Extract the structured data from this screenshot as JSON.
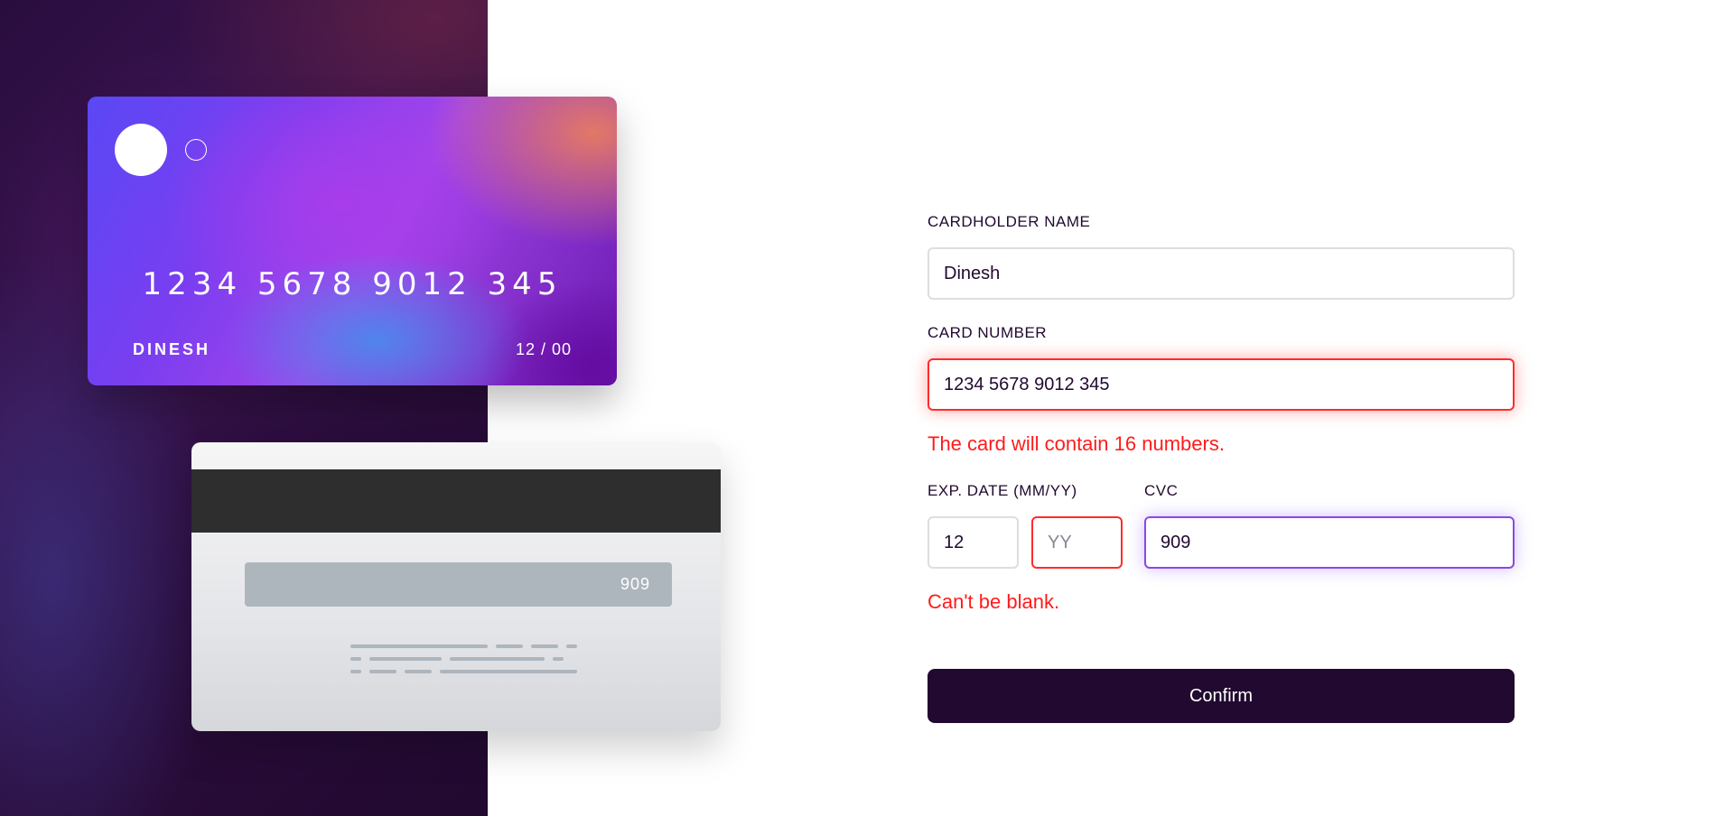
{
  "card_front": {
    "number": "1234 5678 9012 345",
    "name": "DINESH",
    "expiry": "12 / 00"
  },
  "card_back": {
    "cvc": "909"
  },
  "form": {
    "cardholder": {
      "label": "CARDHOLDER NAME",
      "value": "Dinesh"
    },
    "card_number": {
      "label": "CARD NUMBER",
      "value": "1234 5678 9012 345",
      "error": "The card will contain 16 numbers."
    },
    "exp_date": {
      "label": "EXP. DATE (MM/YY)",
      "month_value": "12",
      "year_placeholder": "YY",
      "error": "Can't be blank."
    },
    "cvc": {
      "label": "CVC",
      "value": "909"
    },
    "confirm_label": "Confirm"
  },
  "colors": {
    "dark_violet": "#21092f",
    "error_red": "#ff1b1b",
    "focus_purple": "#8b47e6"
  },
  "icons": [
    "card-logo-circle-filled-icon",
    "card-logo-circle-outline-icon"
  ]
}
